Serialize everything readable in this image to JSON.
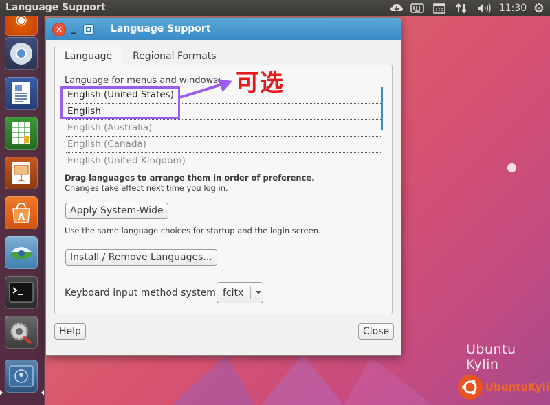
{
  "top_panel": {
    "title": "Language Support",
    "clock": "11:30",
    "tray_icons": [
      "sync-icon",
      "keyboard-icon",
      "calendar-icon",
      "network-icon",
      "volume-icon",
      "gear-icon"
    ]
  },
  "launcher": {
    "items": [
      "firefox-icon",
      "chromium-icon",
      "writer-icon",
      "calc-icon",
      "impress-icon",
      "software-center-icon",
      "software-updater-icon",
      "terminal-icon",
      "system-settings-icon",
      "workspace-switcher-icon"
    ]
  },
  "dialog": {
    "title": "Language Support",
    "tabs": [
      {
        "label": "Language",
        "active": true
      },
      {
        "label": "Regional Formats",
        "active": false
      }
    ],
    "list_label": "Language for menus and windows:",
    "languages": [
      {
        "name": "English (United States)",
        "enabled": true
      },
      {
        "name": "English",
        "enabled": true
      },
      {
        "name": "English (Australia)",
        "enabled": false
      },
      {
        "name": "English (Canada)",
        "enabled": false
      },
      {
        "name": "English (United Kingdom)",
        "enabled": false
      }
    ],
    "hint_bold": "Drag languages to arrange them in order of preference.",
    "hint_normal": "Changes take effect next time you log in.",
    "apply_button": "Apply System-Wide",
    "apply_note": "Use the same language choices for startup and the login screen.",
    "install_button": "Install / Remove Languages...",
    "keyboard_label": "Keyboard input method system:",
    "keyboard_value": "fcitx",
    "help_button": "Help",
    "close_button": "Close"
  },
  "annotation": {
    "text": "可选",
    "color": "#e31b1b",
    "box_color": "#9b5cf0"
  },
  "desktop": {
    "label": "Ubuntu Kylin",
    "brand": "UbuntuKylin",
    "brand_color": "#f26a20"
  }
}
